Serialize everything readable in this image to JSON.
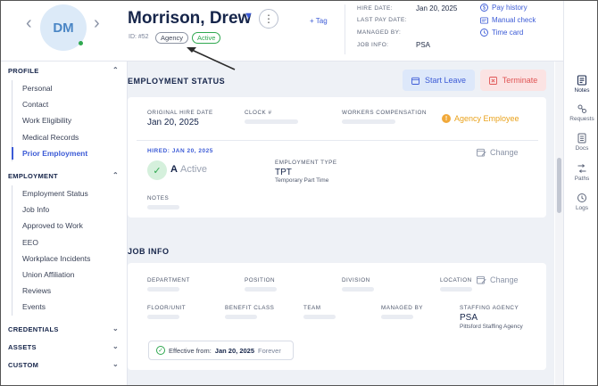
{
  "header": {
    "avatar_initials": "DM",
    "employee_name": "Morrison, Drew",
    "add_tag_label": "+ Tag",
    "employee_id": "ID: #52",
    "badges": {
      "agency": "Agency",
      "active": "Active"
    },
    "meta": [
      {
        "label": "HIRE DATE:",
        "value": "Jan 20, 2025"
      },
      {
        "label": "LAST PAY DATE:",
        "value": ""
      },
      {
        "label": "MANAGED BY:",
        "value": ""
      },
      {
        "label": "JOB INFO:",
        "value": "PSA"
      }
    ],
    "quick_links": [
      {
        "label": "Pay history",
        "icon": "dollar-icon"
      },
      {
        "label": "Manual check",
        "icon": "check-card-icon"
      },
      {
        "label": "Time card",
        "icon": "clock-icon"
      }
    ]
  },
  "sidebar": {
    "sections": [
      {
        "title": "PROFILE",
        "expanded": true,
        "items": [
          "Personal",
          "Contact",
          "Work Eligibility",
          "Medical Records",
          "Prior Employment"
        ],
        "active": "Prior Employment"
      },
      {
        "title": "EMPLOYMENT",
        "expanded": true,
        "items": [
          "Employment Status",
          "Job Info",
          "Approved to Work",
          "EEO",
          "Workplace Incidents",
          "Union Affiliation",
          "Reviews",
          "Events"
        ]
      },
      {
        "title": "CREDENTIALS",
        "expanded": false,
        "items": []
      },
      {
        "title": "ASSETS",
        "expanded": false,
        "items": []
      },
      {
        "title": "CUSTOM",
        "expanded": false,
        "items": []
      }
    ]
  },
  "employment_status": {
    "title": "EMPLOYMENT STATUS",
    "start_leave_label": "Start Leave",
    "terminate_label": "Terminate",
    "original_hire_date_label": "ORIGINAL HIRE DATE",
    "original_hire_date": "Jan 20, 2025",
    "clock_label": "CLOCK #",
    "workers_comp_label": "WORKERS COMPENSATION",
    "agency_flag": "Agency Employee",
    "hired_label": "HIRED: JAN 20, 2025",
    "status_letter": "A",
    "status_word": "Active",
    "employment_type_label": "EMPLOYMENT TYPE",
    "employment_type": "TPT",
    "employment_type_desc": "Temporary Part Time",
    "change_label": "Change",
    "notes_label": "NOTES"
  },
  "job_info": {
    "title": "JOB INFO",
    "department_label": "DEPARTMENT",
    "position_label": "POSITION",
    "division_label": "DIVISION",
    "location_label": "LOCATION",
    "change_label": "Change",
    "floor_unit_label": "FLOOR/UNIT",
    "benefit_class_label": "BENEFIT CLASS",
    "team_label": "TEAM",
    "managed_by_label": "MANAGED BY",
    "staffing_agency_label": "STAFFING AGENCY",
    "staffing_agency": "PSA",
    "staffing_agency_name": "Pittsford Staffing Agency",
    "effective_from_label": "Effective from:",
    "effective_date": "Jan 20, 2025",
    "effective_end": "Forever"
  },
  "rail": [
    {
      "label": "Notes",
      "icon": "notes-icon",
      "active": true
    },
    {
      "label": "Requests",
      "icon": "requests-icon"
    },
    {
      "label": "Docs",
      "icon": "docs-icon"
    },
    {
      "label": "Paths",
      "icon": "paths-icon"
    },
    {
      "label": "Logs",
      "icon": "logs-icon"
    }
  ],
  "colors": {
    "accent": "#3c5bd6",
    "success": "#2fa84f",
    "danger": "#e05555",
    "warning": "#e9a21c"
  }
}
